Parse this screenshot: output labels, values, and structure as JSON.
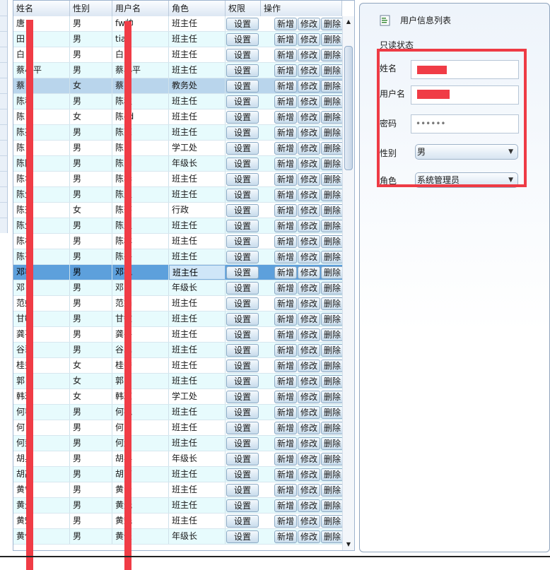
{
  "grid": {
    "columns": [
      "姓名",
      "性别",
      "用户名",
      "角色",
      "权限",
      "操作"
    ],
    "action_labels": {
      "setting": "设置",
      "add": "新增",
      "edit": "修改",
      "delete": "删除"
    },
    "rows": [
      {
        "name": "唐",
        "gender": "男",
        "username": "fw帅",
        "role": "班主任"
      },
      {
        "name": "田",
        "gender": "男",
        "username": "tia",
        "role": "班主任"
      },
      {
        "name": "白",
        "gender": "男",
        "username": "白",
        "role": "班主任"
      },
      {
        "name": "蔡小平",
        "gender": "男",
        "username": "蔡小平",
        "role": "班主任"
      },
      {
        "name": "蔡",
        "gender": "女",
        "username": "蔡",
        "role": "教务处"
      },
      {
        "name": "陈秋",
        "gender": "男",
        "username": "陈秋",
        "role": "班主任"
      },
      {
        "name": "陈",
        "gender": "女",
        "username": "陈cd",
        "role": "班主任"
      },
      {
        "name": "陈亮",
        "gender": "男",
        "username": "陈亮",
        "role": "班主任"
      },
      {
        "name": "陈",
        "gender": "男",
        "username": "陈",
        "role": "学工处"
      },
      {
        "name": "陈刚",
        "gender": "男",
        "username": "陈刚",
        "role": "年级长"
      },
      {
        "name": "陈华",
        "gender": "男",
        "username": "陈华",
        "role": "班主任"
      },
      {
        "name": "陈生",
        "gender": "男",
        "username": "陈生",
        "role": "班主任"
      },
      {
        "name": "陈莎",
        "gender": "女",
        "username": "陈莎",
        "role": "行政"
      },
      {
        "name": "陈生",
        "gender": "男",
        "username": "陈生",
        "role": "班主任"
      },
      {
        "name": "陈林",
        "gender": "男",
        "username": "陈林",
        "role": "班主任"
      },
      {
        "name": "陈平",
        "gender": "男",
        "username": "陈平",
        "role": "班主任"
      },
      {
        "name": "邓艳",
        "gender": "男",
        "username": "邓艳",
        "role": "班主任"
      },
      {
        "name": "邓",
        "gender": "男",
        "username": "邓",
        "role": "年级长"
      },
      {
        "name": "范娟",
        "gender": "男",
        "username": "范娟",
        "role": "班主任"
      },
      {
        "name": "甘敏",
        "gender": "男",
        "username": "甘敏",
        "role": "班主任"
      },
      {
        "name": "龚平",
        "gender": "男",
        "username": "龚平",
        "role": "班主任"
      },
      {
        "name": "谷翠",
        "gender": "男",
        "username": "谷翠",
        "role": "班主任"
      },
      {
        "name": "桂秀",
        "gender": "女",
        "username": "桂秀",
        "role": "班主任"
      },
      {
        "name": "郭",
        "gender": "女",
        "username": "郭",
        "role": "班主任"
      },
      {
        "name": "韩琼",
        "gender": "女",
        "username": "韩琼",
        "role": "学工处"
      },
      {
        "name": "何艳",
        "gender": "男",
        "username": "何艳",
        "role": "班主任"
      },
      {
        "name": "何",
        "gender": "男",
        "username": "何1",
        "role": "班主任"
      },
      {
        "name": "何刲",
        "gender": "男",
        "username": "何刲",
        "role": "班主任"
      },
      {
        "name": "胡兵",
        "gender": "男",
        "username": "胡兵",
        "role": "年级长"
      },
      {
        "name": "胡高",
        "gender": "男",
        "username": "胡高",
        "role": "班主任"
      },
      {
        "name": "黄宁",
        "gender": "男",
        "username": "黄宁",
        "role": "班主任"
      },
      {
        "name": "黄光",
        "gender": "男",
        "username": "黄光",
        "role": "班主任"
      },
      {
        "name": "黄魁",
        "gender": "男",
        "username": "黄魁",
        "role": "班主任"
      },
      {
        "name": "黄俊",
        "gender": "男",
        "username": "黄俊",
        "role": "年级长"
      }
    ]
  },
  "detail": {
    "title": "用户信息列表",
    "readonly_label": "只读状态",
    "fields": {
      "name_label": "姓名",
      "username_label": "用户名",
      "password_label": "密码",
      "password_value": "••••••",
      "gender_label": "性别",
      "gender_value": "男",
      "role_label": "角色",
      "role_value": "系统管理员"
    }
  },
  "colors": {
    "row_alt": "#e7fbfd",
    "row_selected": "#5da0dc",
    "row_highlight": "#b9d5ec",
    "redaction": "#f03c46"
  },
  "icons": {
    "panel": "list-icon",
    "scroll_up": "triangle-up-icon",
    "scroll_down": "triangle-down-icon",
    "dropdown": "triangle-down-icon"
  }
}
